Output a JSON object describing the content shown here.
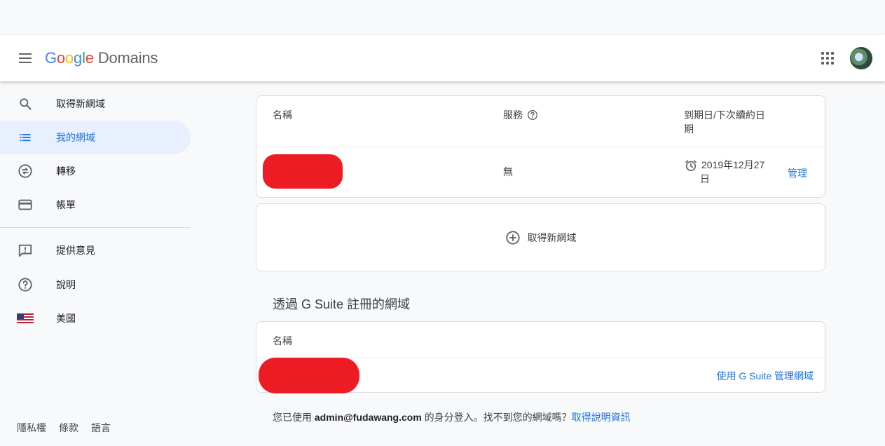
{
  "app": {
    "logo_letters": [
      "G",
      "o",
      "o",
      "g",
      "l",
      "e"
    ],
    "product": "Domains"
  },
  "sidebar": {
    "items": [
      {
        "label": "取得新網域",
        "icon": "search-icon",
        "active": false
      },
      {
        "label": "我的網域",
        "icon": "list-icon",
        "active": true
      },
      {
        "label": "轉移",
        "icon": "transfer-icon",
        "active": false
      },
      {
        "label": "帳單",
        "icon": "credit-card-icon",
        "active": false
      },
      {
        "label": "提供意見",
        "icon": "feedback-icon",
        "active": false
      },
      {
        "label": "說明",
        "icon": "help-icon",
        "active": false
      },
      {
        "label": "美國",
        "icon": "us-flag-icon",
        "active": false
      }
    ],
    "footer": [
      "隱私權",
      "條款",
      "語言"
    ]
  },
  "domains_table": {
    "headers": {
      "name": "名稱",
      "service": "服務",
      "expiry_line1": "到期日/下次續約日",
      "expiry_line2": "期"
    },
    "row": {
      "service": "無",
      "expiry_line1": "2019年12月27",
      "expiry_line2": "日",
      "action": "管理"
    }
  },
  "add_domain": {
    "label": "取得新網域"
  },
  "gsuite": {
    "title": "透過 G Suite 註冊的網域",
    "header_name": "名稱",
    "action": "使用 G Suite 管理網域"
  },
  "login_note": {
    "prefix": "您已使用 ",
    "email": "admin@fudawang.com",
    "suffix": " 的身分登入。找不到您的網域嗎？",
    "help_link": "取得說明資訊"
  },
  "colors": {
    "accent": "#1a73e8",
    "redaction": "#ed1c24",
    "active_bg": "#e8f0fe"
  }
}
